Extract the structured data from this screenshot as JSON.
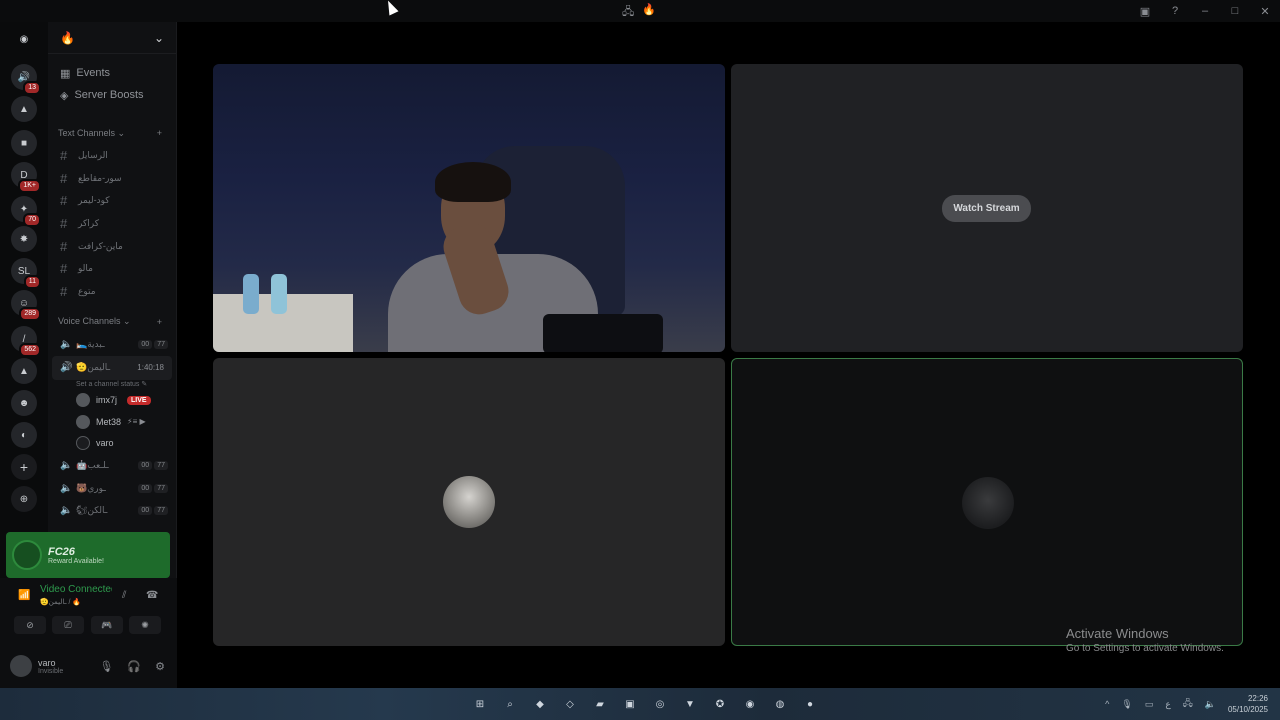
{
  "titlebar": {
    "center_icons": [
      "🖧",
      "🔥"
    ],
    "right_icons": [
      "inbox-icon",
      "help-icon",
      "minimize-icon",
      "maximize-icon",
      "close-icon"
    ]
  },
  "rail": {
    "servers": [
      {
        "name": "discord-home",
        "glyph": "◉",
        "badge": ""
      },
      {
        "name": "server-1",
        "glyph": "🔊",
        "badge": "13"
      },
      {
        "name": "server-2",
        "glyph": "▲",
        "badge": ""
      },
      {
        "name": "server-3",
        "glyph": "■",
        "badge": ""
      },
      {
        "name": "server-4",
        "glyph": "D",
        "badge": "1K+"
      },
      {
        "name": "server-5",
        "glyph": "✦",
        "badge": "70"
      },
      {
        "name": "server-6",
        "glyph": "✸",
        "badge": ""
      },
      {
        "name": "server-7",
        "glyph": "SL",
        "badge": "11"
      },
      {
        "name": "server-8",
        "glyph": "☺",
        "badge": "289"
      },
      {
        "name": "server-9",
        "glyph": "/",
        "badge": "562"
      },
      {
        "name": "server-10",
        "glyph": "▲",
        "badge": ""
      },
      {
        "name": "server-11",
        "glyph": "☻",
        "badge": ""
      },
      {
        "name": "server-12",
        "glyph": "◐",
        "badge": ""
      }
    ],
    "add_server": "+",
    "discover": "⊕"
  },
  "sidebar": {
    "server_name": "🔥",
    "nav": [
      {
        "icon": "▦",
        "label": "Events"
      },
      {
        "icon": "◈",
        "label": "Server Boosts"
      }
    ],
    "text_category": "Text Channels",
    "text_channels": [
      "الرسايل",
      "سور-مقاطع",
      "كود-ليمر",
      "كراكر",
      "ماين-كرافت",
      "مالو",
      "متوع"
    ],
    "voice_category": "Voice Channels",
    "voice_channels": [
      {
        "name": "🛌ـبدية",
        "c1": "00",
        "c2": "77"
      }
    ],
    "active_voice": {
      "name": "🫡ـاليمن",
      "time": "1:40:18",
      "status": "Set a channel status ✎"
    },
    "members": [
      {
        "name": "imx7j",
        "live": "LIVE",
        "extra": ""
      },
      {
        "name": "Met38",
        "live": "",
        "extra": "⚡≡ ▶"
      },
      {
        "name": "varo",
        "live": "",
        "extra": ""
      }
    ],
    "more_voice": [
      {
        "name": "🤖ـلـعب",
        "c1": "00",
        "c2": "77"
      },
      {
        "name": "🐻ـوري",
        "c1": "00",
        "c2": "77"
      },
      {
        "name": "🐿ـالكن",
        "c1": "00",
        "c2": "77"
      }
    ]
  },
  "reward": {
    "title": "FC26",
    "subtitle": "Reward Available!"
  },
  "voice_panel": {
    "status": "Video Connected",
    "channel": "🫡ـاليمن / 🔥",
    "buttons": [
      "⊘",
      "⎚",
      "🎮",
      "✺"
    ]
  },
  "user": {
    "name": "varo",
    "status": "Invisible"
  },
  "stage": {
    "watch_stream": "Watch Stream"
  },
  "activate": {
    "line1": "Activate Windows",
    "line2": "Go to Settings to activate Windows."
  },
  "taskbar": {
    "apps": [
      "⊞",
      "⌕",
      "◆",
      "◇",
      "▰",
      "▣",
      "◎",
      "▼",
      "✪",
      "◉",
      "◍",
      "●"
    ],
    "tray": [
      "^",
      "🎙",
      "▭",
      "ع",
      "🖧",
      "🔈"
    ],
    "time": "22:26",
    "date": "05/10/2025"
  },
  "colors": {
    "live": "#c42b2b",
    "connected": "#2e9b4d",
    "reward_bg": "#1e6b2b",
    "active_border": "#3a7a46"
  }
}
